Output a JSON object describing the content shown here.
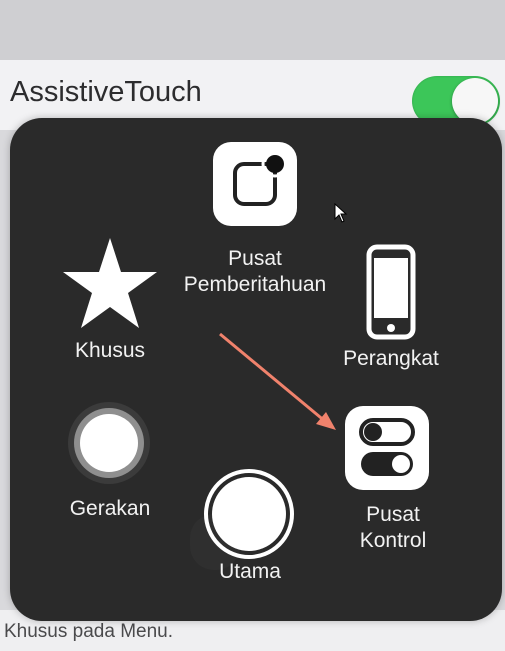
{
  "settings": {
    "assistive_label": "AssistiveTouch",
    "assistive_enabled": true,
    "footer_text": "Khusus pada Menu."
  },
  "menu": {
    "items": [
      {
        "id": "notifications",
        "label": "Pusat\nPemberitahuan",
        "icon": "notification-center-icon"
      },
      {
        "id": "custom",
        "label": "Khusus",
        "icon": "star-icon"
      },
      {
        "id": "device",
        "label": "Perangkat",
        "icon": "device-icon"
      },
      {
        "id": "gestures",
        "label": "Gerakan",
        "icon": "gesture-circle-icon"
      },
      {
        "id": "home",
        "label": "Utama",
        "icon": "home-button-icon"
      },
      {
        "id": "control",
        "label": "Pusat\nKontrol",
        "icon": "control-center-icon"
      }
    ]
  },
  "annotation": {
    "arrow_color": "#f0826c"
  },
  "colors": {
    "toggle_on": "#3cc659",
    "panel_bg": "#2a2a2a",
    "label_text": "#f2f2f2"
  }
}
